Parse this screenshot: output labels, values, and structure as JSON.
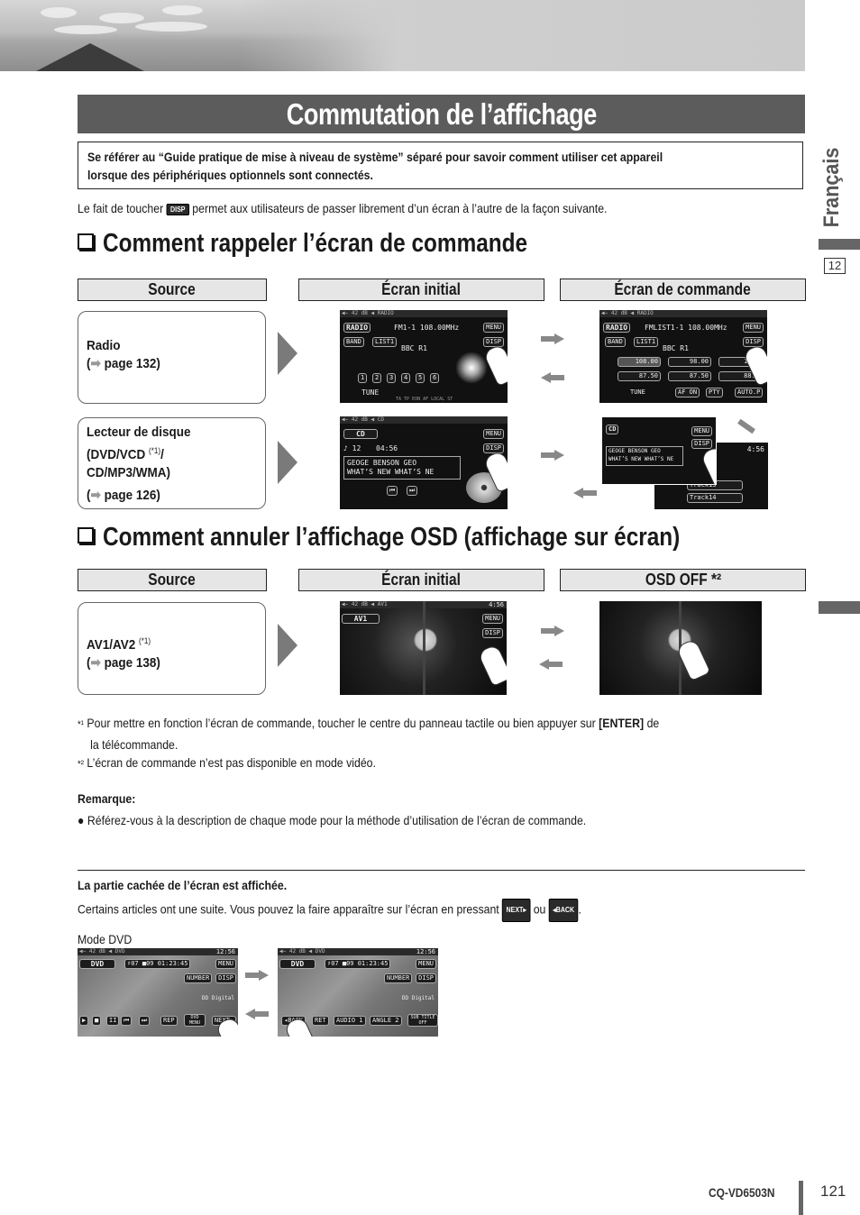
{
  "header": {
    "title": "Commutation de l’affichage",
    "notice": [
      "Se référer au “Guide pratique de mise à niveau de système” séparé pour savoir comment utiliser cet appareil",
      "lorsque des périphériques optionnels sont connectés."
    ],
    "intro_before": "Le fait de toucher",
    "intro_button": "DISP",
    "intro_after": "permet aux utilisateurs de passer librement d’un écran à l’autre de la façon suivante."
  },
  "side": {
    "language_tab": "Français",
    "section_number": "12"
  },
  "section1": {
    "heading": "Comment rappeler l’écran de commande",
    "columns": [
      "Source",
      "Écran initial",
      "Écran de commande"
    ],
    "rows": [
      {
        "source_lines": [
          "Radio"
        ],
        "page_ref": "page 132",
        "initial_screen": {
          "status": "◀− 42 dB ◀ RADIO",
          "mode": "RADIO",
          "freq": "FM1-1  108.00MHz",
          "station": "BBC R1",
          "buttons": [
            "BAND",
            "LIST1",
            "MENU",
            "DISP"
          ],
          "presets": [
            "1",
            "2",
            "3",
            "4",
            "5",
            "6"
          ],
          "tune": "TUNE",
          "indicators": "TA TP EON AF LOCAL   ST"
        },
        "command_screen": {
          "mode": "RADIO",
          "freq": "FMLIST1-1  108.00MHz",
          "station": "BBC R1",
          "buttons": [
            "BAND",
            "LIST1",
            "MENU",
            "DISP"
          ],
          "presets": [
            "108.00",
            "98.00",
            "107.",
            "87.50",
            "87.50",
            "88.0"
          ],
          "bottom": [
            "TUNE",
            "AF ON",
            "PTY",
            "AUTO.P"
          ]
        }
      },
      {
        "source_lines": [
          "Lecteur de disque",
          "(DVD/VCD",
          "CD/MP3/WMA)"
        ],
        "footnote_ref": "(*1)",
        "page_ref": "page 126",
        "initial_screen": {
          "status": "◀− 42 dB ◀ CD",
          "mode": "CD",
          "track": "♪ 12",
          "time": "04:56",
          "lines": [
            "GEOGE BENSON GEO",
            "WHAT’S NEW WHAT’S NE"
          ],
          "buttons": [
            "MENU",
            "DISP"
          ]
        },
        "command_screen": {
          "mode": "CD",
          "time": "4:56",
          "lines": [
            "GEOGE BENSON GEO",
            "WHAT’S NEW WHAT’S NE"
          ],
          "tracks": [
            "Track13",
            "Track14"
          ],
          "buttons": [
            "MENU",
            "DISP"
          ]
        }
      }
    ]
  },
  "section2": {
    "heading": "Comment annuler l’affichage OSD (affichage sur écran)",
    "columns": [
      "Source",
      "Écran initial",
      "OSD OFF *²"
    ],
    "rows": [
      {
        "source": "AV1/AV2",
        "footnote_ref": "(*1)",
        "page_ref": "page 138",
        "initial_screen": {
          "status": "◀− 42 dB ◀ AV1",
          "mode": "AV1",
          "time": "4:56",
          "buttons": [
            "MENU",
            "DISP"
          ]
        }
      }
    ]
  },
  "footnotes": [
    {
      "mark": "*¹",
      "text_before": "Pour mettre en fonction l’écran de commande, toucher le centre du panneau tactile ou bien appuyer sur",
      "bold": "[ENTER]",
      "text_after": "de",
      "continuation": "la télécommande."
    },
    {
      "mark": "*²",
      "text": "L’écran de commande n’est pas disponible en mode vidéo."
    }
  ],
  "remark": {
    "label": "Remarque:",
    "bullet": "Référez-vous à la description de chaque mode pour la méthode d’utilisation de l’écran de commande."
  },
  "hidden_part": {
    "heading": "La partie cachée de l’écran est affichée.",
    "text_before": "Certains articles ont une suite. Vous pouvez la faire apparaître sur l’écran en pressant",
    "next_button": "NEXT▸",
    "or": "ou",
    "back_button": "◂BACK",
    "text_after": ".",
    "mode_label": "Mode DVD",
    "screen_a": {
      "status": "◀− 42 dB ◀ DVD",
      "time": "12:56",
      "mode": "DVD",
      "info": "♯07 ■09 01:23:45",
      "buttons": [
        "MENU",
        "NUMBER",
        "DISP"
      ],
      "digital": "DD Digital",
      "controls": [
        "▶",
        "■",
        "II",
        "⏮",
        "⏭",
        "REP",
        "DVD MENU",
        "NEXT▸"
      ]
    },
    "screen_b": {
      "status": "◀− 42 dB ◀ DVD",
      "time": "12:56",
      "mode": "DVD",
      "info": "♯07 ■09 01:23:45",
      "buttons": [
        "MENU",
        "NUMBER",
        "DISP"
      ],
      "digital": "DD Digital",
      "controls": [
        "◂BACK",
        "RET",
        "AUDIO 1",
        "ANGLE 2",
        "SUB TITLE OFF"
      ]
    }
  },
  "footer": {
    "model": "CQ-VD6503N",
    "page_number": "121"
  }
}
